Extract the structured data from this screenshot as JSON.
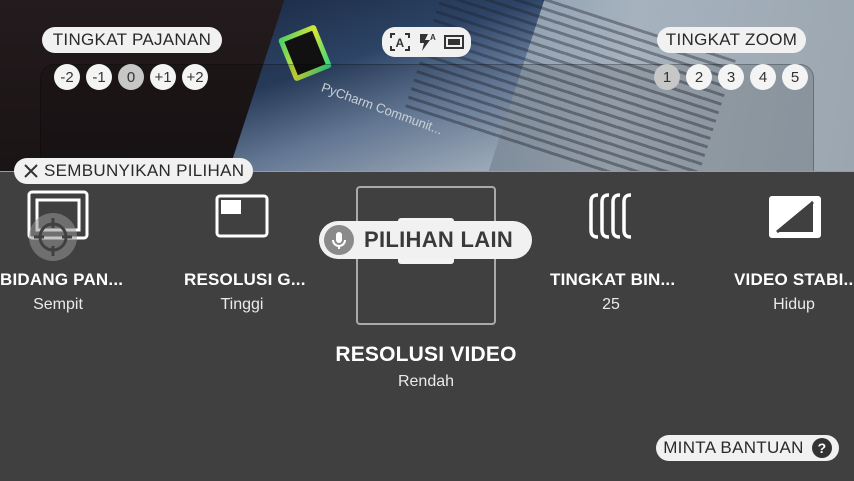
{
  "exposure": {
    "label": "TINGKAT PAJANAN",
    "levels": [
      "-2",
      "-1",
      "0",
      "+1",
      "+2"
    ],
    "selected": "0"
  },
  "zoom": {
    "label": "TINGKAT ZOOM",
    "levels": [
      "1",
      "2",
      "3",
      "4",
      "5"
    ],
    "selected": "1"
  },
  "viewfinder": {
    "screen_text": "PyCharm Communit..."
  },
  "hide_options_label": "SEMBUNYIKAN PILIHAN",
  "options": [
    {
      "title": "BIDANG PAN...",
      "value": "Sempit",
      "icon": "field-of-view-icon"
    },
    {
      "title": "RESOLUSI G...",
      "value": "Tinggi",
      "icon": "image-resolution-icon"
    },
    {
      "title": "RESOLUSI VIDEO",
      "value": "Rendah",
      "icon": "video-resolution-icon"
    },
    {
      "title": "TINGKAT BIN...",
      "value": "25",
      "icon": "binning-level-icon"
    },
    {
      "title": "VIDEO STABI...",
      "value": "Hidup",
      "icon": "video-stabilization-icon"
    }
  ],
  "more_options_label": "PILIHAN LAIN",
  "help_label": "MINTA BANTUAN",
  "colors": {
    "panel_bg": "#404040",
    "pill_bg": "#f1f1f1"
  }
}
